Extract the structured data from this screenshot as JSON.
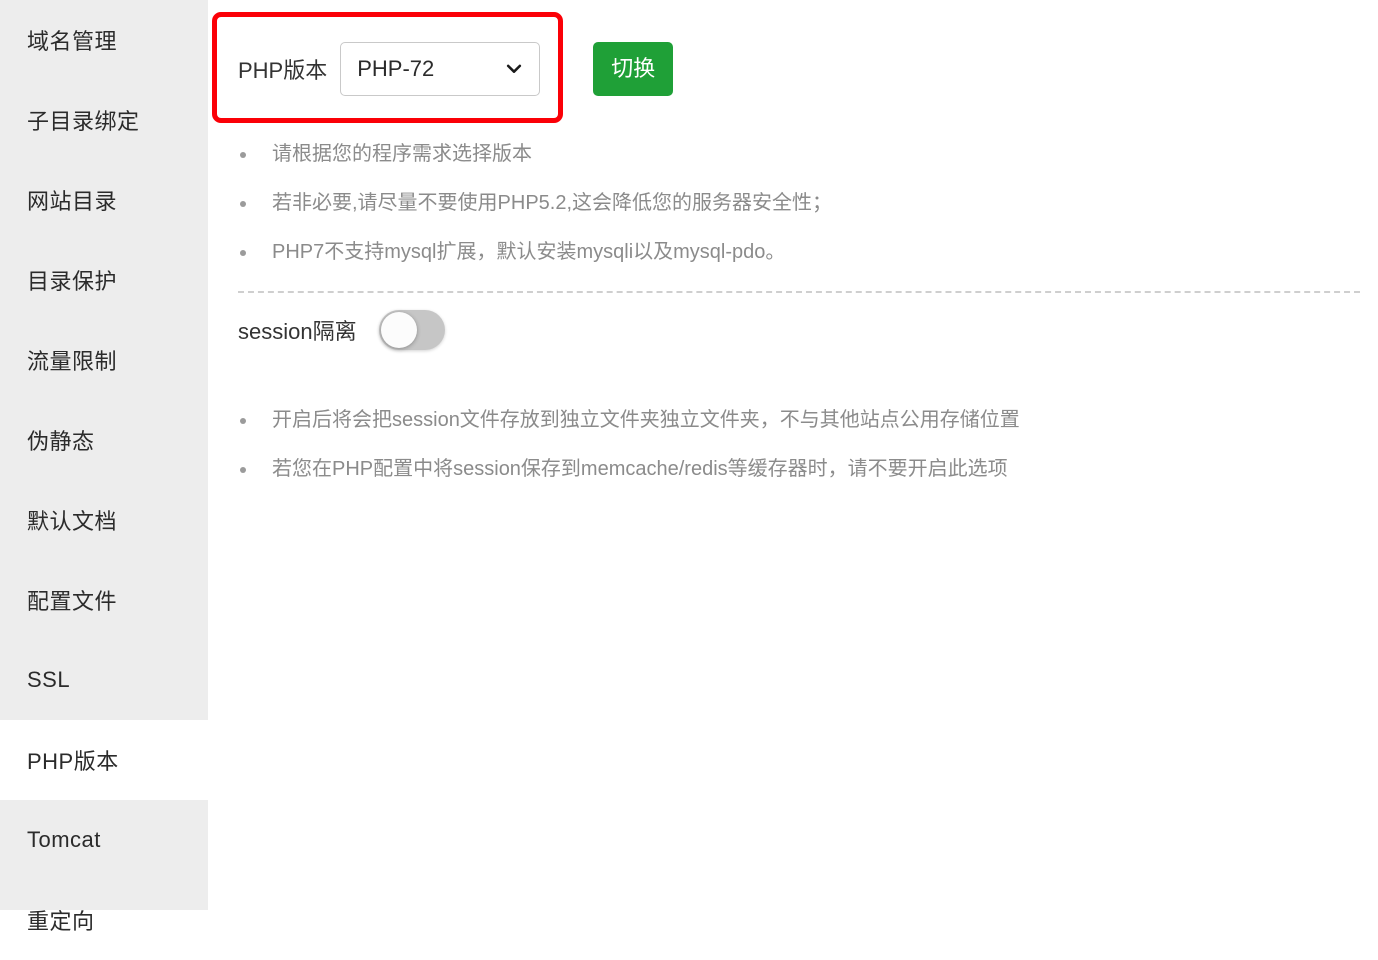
{
  "sidebar": {
    "items": [
      {
        "label": "域名管理",
        "active": false
      },
      {
        "label": "子目录绑定",
        "active": false
      },
      {
        "label": "网站目录",
        "active": false
      },
      {
        "label": "目录保护",
        "active": false
      },
      {
        "label": "流量限制",
        "active": false
      },
      {
        "label": "伪静态",
        "active": false
      },
      {
        "label": "默认文档",
        "active": false
      },
      {
        "label": "配置文件",
        "active": false
      },
      {
        "label": "SSL",
        "active": false
      },
      {
        "label": "PHP版本",
        "active": true
      },
      {
        "label": "Tomcat",
        "active": false
      },
      {
        "label": "重定向",
        "active": false
      }
    ]
  },
  "php_version": {
    "label": "PHP版本",
    "selected": "PHP-72",
    "options": [
      "PHP-72"
    ],
    "switch_button": "切换",
    "chevron_icon": "chevron-down-icon",
    "highlight_color": "#fb0007",
    "button_color": "#1fa037",
    "notes": [
      "请根据您的程序需求选择版本",
      "若非必要,请尽量不要使用PHP5.2,这会降低您的服务器安全性；",
      "PHP7不支持mysql扩展，默认安装mysqli以及mysql-pdo。"
    ]
  },
  "session_isolation": {
    "label": "session隔离",
    "enabled": false,
    "notes": [
      "开启后将会把session文件存放到独立文件夹独立文件夹，不与其他站点公用存储位置",
      "若您在PHP配置中将session保存到memcache/redis等缓存器时，请不要开启此选项"
    ]
  }
}
